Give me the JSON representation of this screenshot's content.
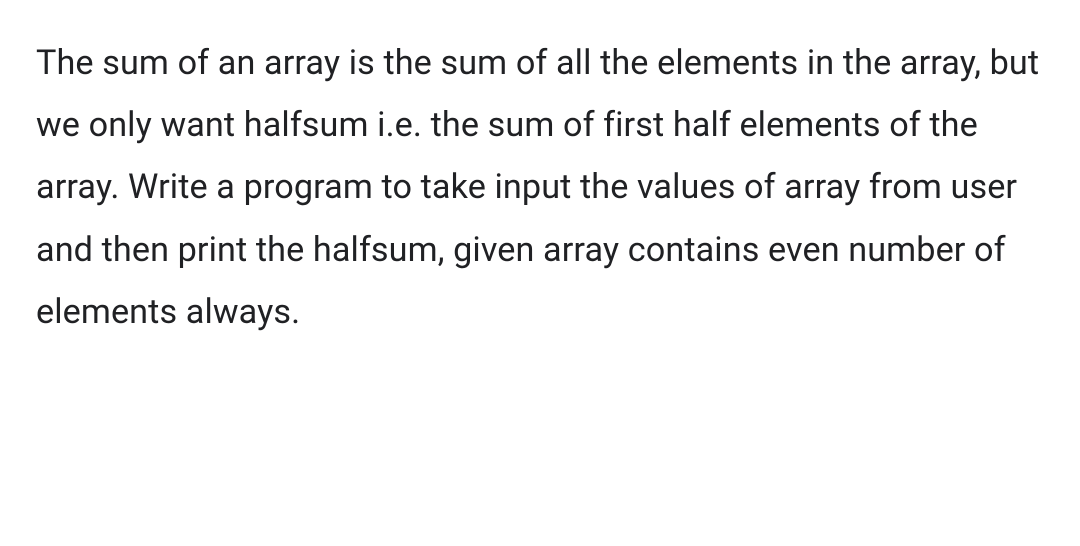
{
  "document": {
    "body_text": "The sum of an array is the sum of all the elements in the array, but we only want halfsum i.e. the sum of first half elements of the array. Write a program to take input the values of array from user and then print the halfsum, given array contains even number of elements always."
  }
}
